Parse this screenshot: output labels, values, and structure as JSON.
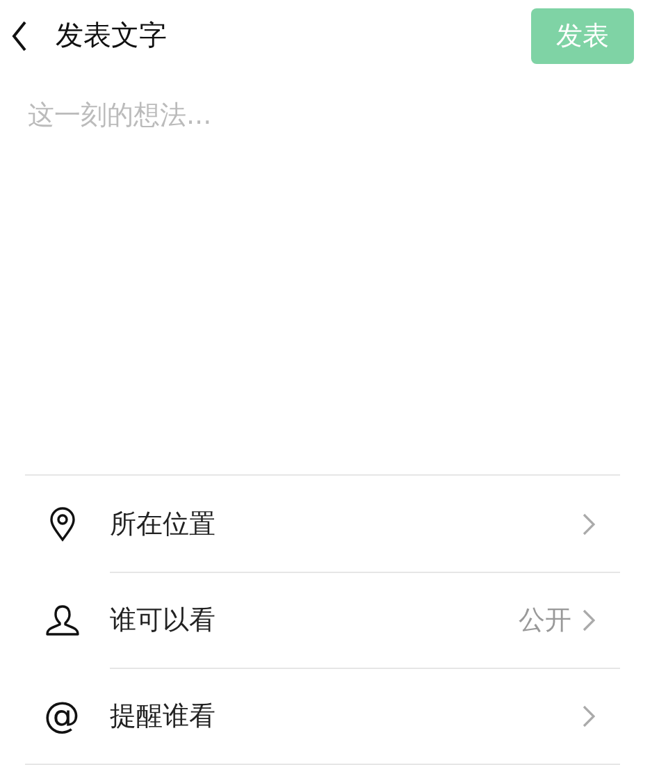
{
  "header": {
    "title": "发表文字",
    "publish_button": {
      "label": "发表",
      "disabled": true
    }
  },
  "editor": {
    "placeholder": "这一刻的想法..."
  },
  "options": [
    {
      "kind": "location",
      "label": "所在位置"
    },
    {
      "kind": "visibility",
      "label": "谁可以看",
      "value": "公开"
    },
    {
      "kind": "mention",
      "label": "提醒谁看",
      "icon_text": "@"
    }
  ]
}
